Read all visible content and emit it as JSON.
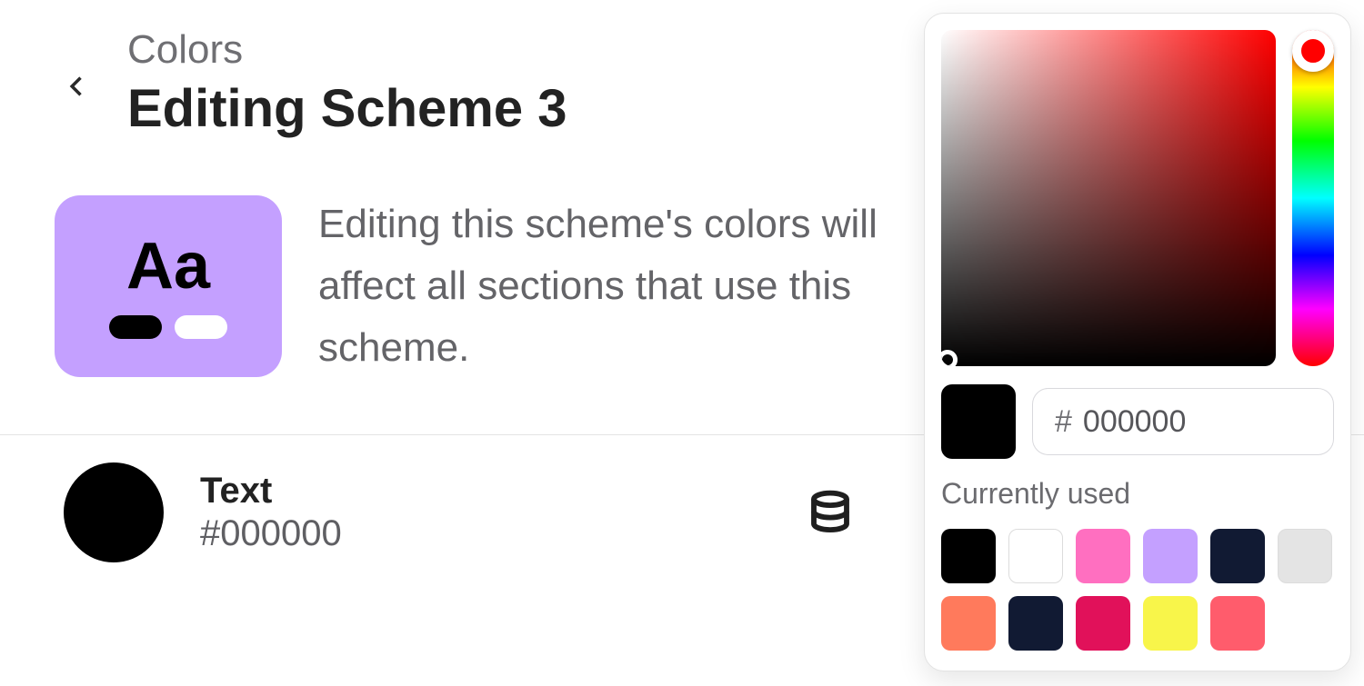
{
  "breadcrumb": "Colors",
  "page_title": "Editing Scheme 3",
  "scheme_preview": {
    "sample_text": "Aa",
    "background_color": "#c4a0ff",
    "pill_dark_color": "#000000",
    "pill_light_color": "#ffffff"
  },
  "info_text": "Editing this scheme's colors will affect all sections that use this scheme.",
  "color_property": {
    "label": "Text",
    "value": "#000000",
    "swatch_color": "#000000"
  },
  "color_picker": {
    "hue_base_color": "#ff0000",
    "current_color": "#000000",
    "hex_prefix": "#",
    "hex_value": "000000",
    "currently_used_label": "Currently used",
    "swatches_row1": [
      "#000000",
      "#ffffff",
      "#ff6fc0",
      "#c4a0ff",
      "#111a33",
      "#e4e4e4"
    ],
    "swatches_row2": [
      "#ff7a5c",
      "#111a33",
      "#e1115a",
      "#f8f54a",
      "#ff5c6c"
    ]
  }
}
